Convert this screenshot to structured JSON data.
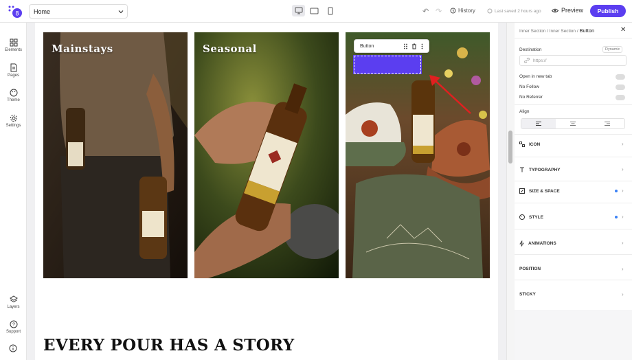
{
  "header": {
    "page_select": "Home",
    "history": "History",
    "saved": "Last saved 2 hours ago",
    "preview": "Preview",
    "publish": "Publish"
  },
  "sidebar": {
    "items": [
      {
        "label": "Elements",
        "icon": "grid-icon"
      },
      {
        "label": "Pages",
        "icon": "page-icon"
      },
      {
        "label": "Theme",
        "icon": "palette-icon"
      },
      {
        "label": "Settings",
        "icon": "gear-icon"
      },
      {
        "label": "Layers",
        "icon": "layers-icon"
      },
      {
        "label": "Support",
        "icon": "help-icon"
      }
    ]
  },
  "canvas": {
    "cards": [
      {
        "title": "Mainstays"
      },
      {
        "title": "Seasonal"
      },
      {
        "title": ""
      }
    ],
    "heading": "EVERY POUR HAS A STORY",
    "popup_label": "Button"
  },
  "panel": {
    "breadcrumb": [
      "Inner Section",
      "Inner Section",
      "Button"
    ],
    "destination_label": "Destination",
    "dynamic": "Dynamic",
    "url_placeholder": "https://",
    "open_new_tab": "Open in new tab",
    "no_follow": "No Follow",
    "no_referrer": "No Referrer",
    "align_label": "Align",
    "sections": [
      "ICON",
      "TYPOGRAPHY",
      "SIZE & SPACE",
      "STYLE",
      "ANIMATIONS",
      "POSITION",
      "STICKY"
    ]
  },
  "colors": {
    "accent": "#5b3ef0",
    "dot": "#3b82f6"
  }
}
